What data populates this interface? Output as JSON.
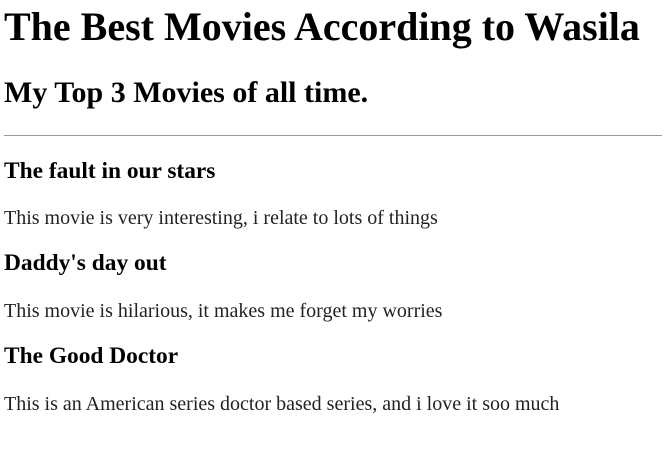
{
  "header": {
    "title": "The Best Movies According to Wasila",
    "subtitle": "My Top 3 Movies of all time."
  },
  "movies": [
    {
      "title": "The fault in our stars",
      "description": "This movie is very interesting, i relate to lots of things"
    },
    {
      "title": "Daddy's day out",
      "description": "This movie is hilarious, it makes me forget my worries"
    },
    {
      "title": "The Good Doctor",
      "description": "This is an American series doctor based series, and i love it soo much"
    }
  ]
}
